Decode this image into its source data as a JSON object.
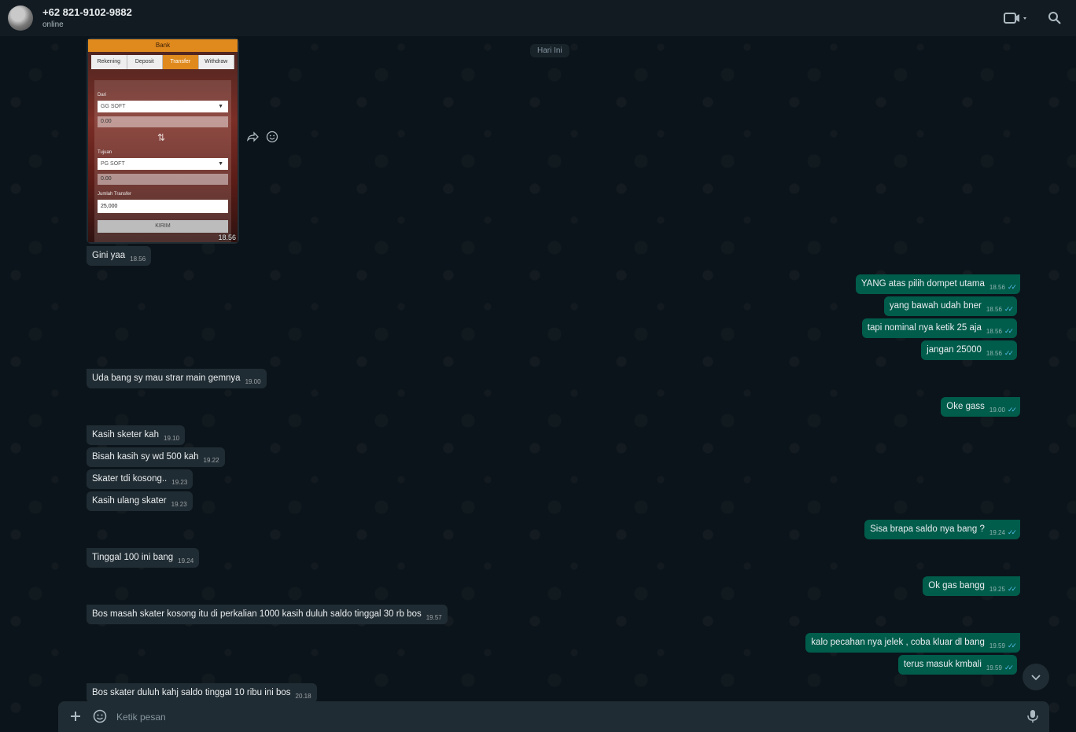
{
  "header": {
    "contact_name": "+62 821-9102-9882",
    "status": "online",
    "icons": [
      "video-call-icon",
      "search-icon"
    ]
  },
  "date_chip": "Hari Ini",
  "image_message": {
    "time": "18.56",
    "screenshot": {
      "title": "Bank",
      "tabs": [
        "Rekening",
        "Deposit",
        "Transfer",
        "Withdraw"
      ],
      "active_tab": "Transfer",
      "from_label": "Dari",
      "from_value": "GG SOFT",
      "from_amount": "0.00",
      "to_label": "Tujuan",
      "to_value": "PG SOFT",
      "to_amount": "0.00",
      "amount_label": "Jumlah Transfer",
      "amount_value": "25,000",
      "submit_label": "KIRIM"
    }
  },
  "messages": [
    {
      "dir": "in",
      "text": "Gini yaa",
      "time": "18.56"
    },
    {
      "dir": "out",
      "text": "YANG atas pilih dompet utama",
      "time": "18.56"
    },
    {
      "dir": "out",
      "text": "yang bawah udah bner",
      "time": "18.56"
    },
    {
      "dir": "out",
      "text": "tapi nominal nya ketik 25 aja",
      "time": "18.56"
    },
    {
      "dir": "out",
      "text": "jangan 25000",
      "time": "18.56"
    },
    {
      "dir": "in",
      "text": "Uda bang sy mau strar main gemnya",
      "time": "19.00"
    },
    {
      "dir": "out",
      "text": "Oke gass",
      "time": "19.00"
    },
    {
      "dir": "in",
      "text": "Kasih sketer kah",
      "time": "19.10"
    },
    {
      "dir": "in",
      "text": "Bisah kasih sy wd 500 kah",
      "time": "19.22"
    },
    {
      "dir": "in",
      "text": "Skater tdi kosong..",
      "time": "19.23"
    },
    {
      "dir": "in",
      "text": "Kasih ulang skater",
      "time": "19.23"
    },
    {
      "dir": "out",
      "text": "Sisa brapa saldo nya bang ?",
      "time": "19.24"
    },
    {
      "dir": "in",
      "text": "Tinggal 100 ini bang",
      "time": "19.24"
    },
    {
      "dir": "out",
      "text": "Ok gas bangg",
      "time": "19.25"
    },
    {
      "dir": "in",
      "text": "Bos masah skater kosong itu di perkalian 1000 kasih duluh saldo tinggal 30 rb bos",
      "time": "19.57"
    },
    {
      "dir": "out",
      "text": "kalo pecahan nya jelek , coba kluar dl bang",
      "time": "19.59"
    },
    {
      "dir": "out",
      "text": "terus masuk kmbali",
      "time": "19.59"
    },
    {
      "dir": "in",
      "text": "Bos skater duluh kahj saldo tinggal 10 ribu ini bos",
      "time": "20.18"
    }
  ],
  "read_tick": "✓✓",
  "composer": {
    "placeholder": "Ketik pesan"
  },
  "colors": {
    "incoming_bubble": "#202c33",
    "outgoing_bubble": "#005c4b",
    "read_tick": "#53bdeb",
    "background": "#0b141a"
  }
}
